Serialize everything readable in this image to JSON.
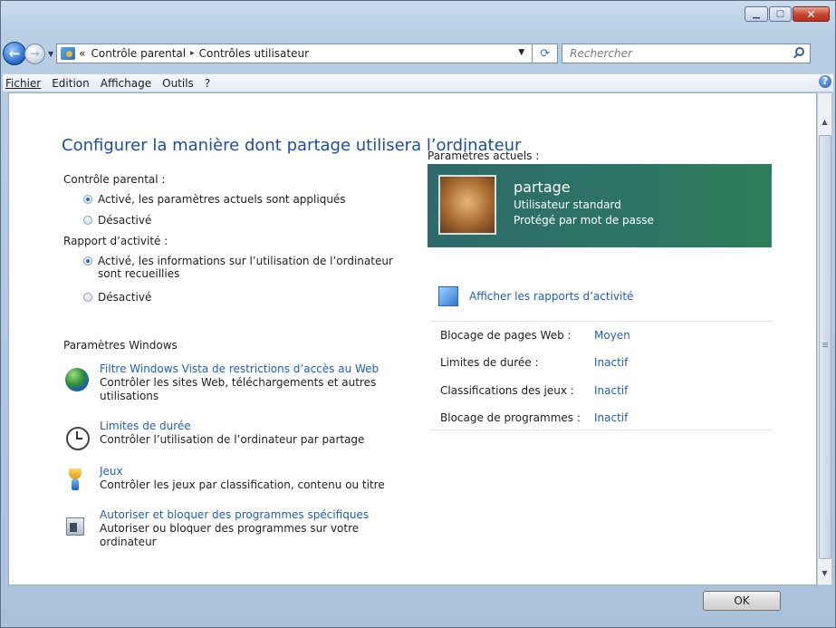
{
  "window": {
    "min_label": "",
    "max_label": "",
    "close_label": "✕"
  },
  "address": {
    "back_icon": "back-arrow-icon",
    "breadcrumb_prefix": "«",
    "crumbs": [
      "Contrôle parental",
      "Contrôles utilisateur"
    ],
    "separator": "▸",
    "search_placeholder": "Rechercher"
  },
  "menu": {
    "items": [
      "Fichier",
      "Edition",
      "Affichage",
      "Outils",
      "?"
    ]
  },
  "page": {
    "title": "Configurer la manière dont partage utilisera l’ordinateur"
  },
  "controle_parental": {
    "label": "Contrôle parental :",
    "options": [
      "Activé, les paramètres actuels sont appliqués",
      "Désactivé"
    ],
    "selected": 0
  },
  "rapport_activite": {
    "label": "Rapport d’activité :",
    "options": [
      "Activé, les informations sur l’utilisation de l’ordinateur sont recueillies",
      "Désactivé"
    ],
    "selected": 0
  },
  "parametres_windows": {
    "label": "Paramètres Windows",
    "tasks": [
      {
        "link": "Filtre Windows Vista de restrictions d’accès au Web",
        "desc": "Contrôler les sites Web, téléchargements et autres utilisations"
      },
      {
        "link": "Limites de durée",
        "desc": "Contrôler l’utilisation de l’ordinateur par partage"
      },
      {
        "link": "Jeux",
        "desc": "Contrôler les jeux par classification, contenu ou titre"
      },
      {
        "link": "Autoriser et bloquer des programmes spécifiques",
        "desc": "Autoriser ou bloquer des programmes sur votre ordinateur"
      }
    ]
  },
  "parametres_actuels": {
    "label": "Paramètres actuels :",
    "user": {
      "name": "partage",
      "role": "Utilisateur standard",
      "password": "Protégé par mot de passe"
    },
    "rapport_link": "Afficher les rapports d’activité",
    "rows": [
      {
        "label": "Blocage de pages Web :",
        "value": "Moyen"
      },
      {
        "label": "Limites de durée :",
        "value": "Inactif"
      },
      {
        "label": "Classifications des jeux :",
        "value": "Inactif"
      },
      {
        "label": "Blocage de programmes :",
        "value": "Inactif"
      }
    ]
  },
  "footer": {
    "ok_label": "OK"
  },
  "colors": {
    "link": "#1c5ec7",
    "title": "#1b4fa0",
    "user_panel": "#2d7566"
  }
}
